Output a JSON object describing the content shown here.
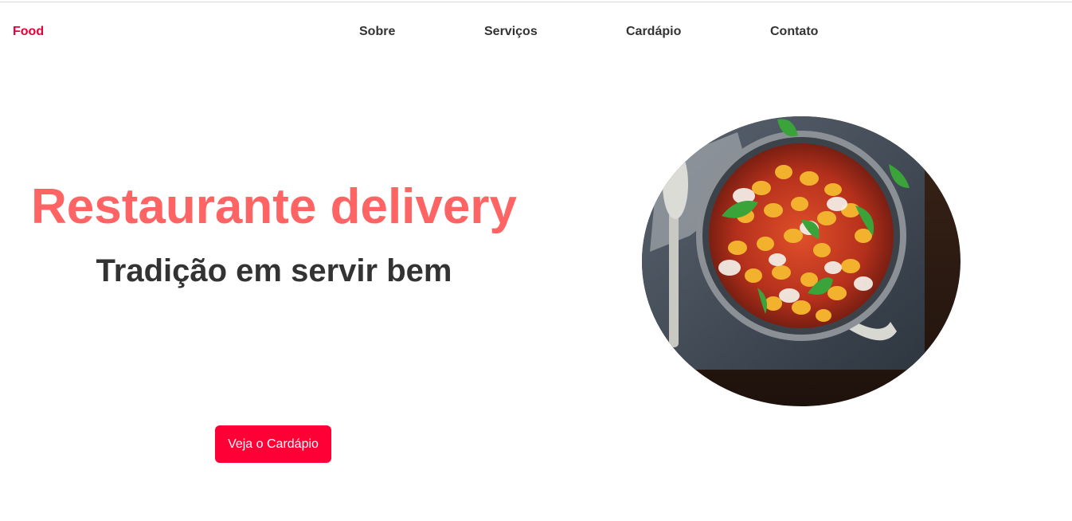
{
  "nav": {
    "brand": "Food",
    "links": [
      "Sobre",
      "Serviços",
      "Cardápio",
      "Contato"
    ]
  },
  "hero": {
    "title": "Restaurante delivery",
    "subtitle": "Tradição em servir bem",
    "cta_label": "Veja o Cardápio",
    "image_alt": "gnocchi-dish-photo"
  },
  "colors": {
    "brand": "#e6003a",
    "title": "#ff6464",
    "button": "#ff0036",
    "text": "#333333"
  }
}
